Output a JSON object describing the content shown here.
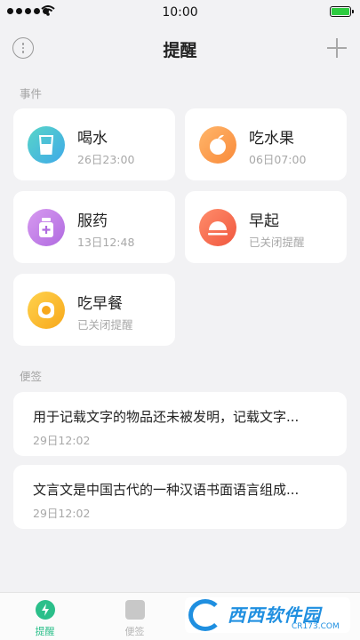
{
  "status_bar": {
    "time": "10:00"
  },
  "nav": {
    "title": "提醒"
  },
  "sections": {
    "events_label": "事件",
    "notes_label": "便签"
  },
  "events": [
    {
      "name": "喝水",
      "time": "26日23:00",
      "icon": "water-glass-icon"
    },
    {
      "name": "吃水果",
      "time": "06日07:00",
      "icon": "orange-fruit-icon"
    },
    {
      "name": "服药",
      "time": "13日12:48",
      "icon": "medicine-bottle-icon"
    },
    {
      "name": "早起",
      "time": "已关闭提醒",
      "icon": "sunrise-icon"
    },
    {
      "name": "吃早餐",
      "time": "已关闭提醒",
      "icon": "fried-egg-icon"
    }
  ],
  "notes": [
    {
      "text": "用于记载文字的物品还未被发明，记载文字...",
      "time": "29日12:02"
    },
    {
      "text": "文言文是中国古代的一种汉语书面语言组成...",
      "time": "29日12:02"
    }
  ],
  "tabs": [
    {
      "label": "提醒",
      "active": true
    },
    {
      "label": "便签",
      "active": false
    },
    {
      "label": "",
      "active": false
    },
    {
      "label": "",
      "active": false
    }
  ],
  "watermark": {
    "text": "西西软件园",
    "url": "CR173.COM"
  },
  "colors": {
    "accent": "#2bbf8a",
    "card_bg": "#ffffff",
    "page_bg": "#f2f2f4"
  }
}
